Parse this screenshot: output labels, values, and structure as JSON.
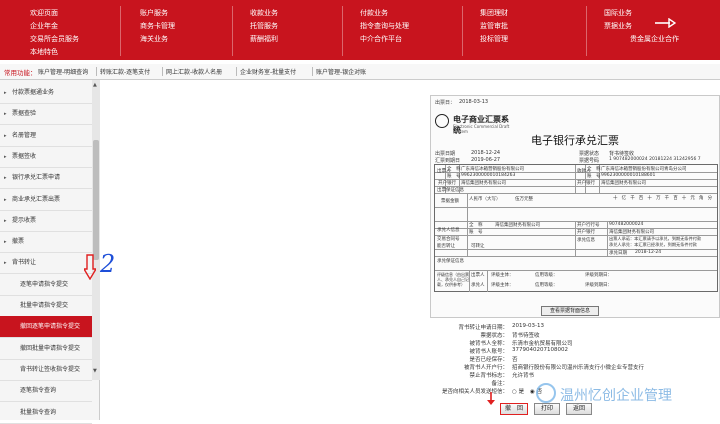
{
  "topnav": {
    "row1": [
      "欢迎页面",
      "账户服务",
      "收款业务",
      "付款业务",
      "集团理财",
      "国际业务"
    ],
    "row2": [
      "企业年金",
      "商务卡管理",
      "托管服务",
      "指令查询与处理",
      "监管审批",
      "票据业务"
    ],
    "row3": [
      "交易所会员服务",
      "海关业务",
      "薪酬福利",
      "中介合作平台",
      "投标管理",
      "贵金属企业合作"
    ],
    "row4": [
      "本地特色"
    ]
  },
  "quick": {
    "label": "常用功能：",
    "items": [
      "账户管理-明细查询",
      "转账汇款-逐笔支付",
      "网上汇款-收款人名册",
      "企业财务室-批量支付",
      "账户管理-银企对账"
    ]
  },
  "sidebar": {
    "items": [
      {
        "label": "付款票据通业务",
        "sub": false
      },
      {
        "label": "票据查验",
        "sub": false
      },
      {
        "label": "名册管理",
        "sub": false
      },
      {
        "label": "票据签收",
        "sub": false
      },
      {
        "label": "银行承兑汇票申请",
        "sub": false
      },
      {
        "label": "商业承兑汇票出票",
        "sub": false
      },
      {
        "label": "提示收票",
        "sub": false
      },
      {
        "label": "撤票",
        "sub": false
      },
      {
        "label": "背书转让",
        "sub": false
      },
      {
        "label": "逐笔申请指令提交",
        "sub": true
      },
      {
        "label": "批量申请指令提交",
        "sub": true
      },
      {
        "label": "撤回逐笔申请指令提交",
        "sub": true,
        "active": true
      },
      {
        "label": "撤回批量申请指令提交",
        "sub": true
      },
      {
        "label": "背书转让签收指令提交",
        "sub": true
      },
      {
        "label": "逐笔指令查询",
        "sub": true
      },
      {
        "label": "批量指令查询",
        "sub": true
      }
    ]
  },
  "annotation": {
    "number": "2"
  },
  "doc": {
    "issue_label": "出票日：",
    "issue_date": "2018-03-13",
    "bank_name": "电子商业汇票系统",
    "bank_name_en": "Electronic Commercial Draft System",
    "title": "电子银行承兑汇票",
    "issue_date_label": "出票日期",
    "issue_date_value": "2018-12-24",
    "due_date_label": "汇票到期日",
    "due_date_value": "2019-06-27",
    "status_label": "票据状态",
    "status_value": "背书待签收",
    "number_label": "票据号码",
    "number_value": "1 907482000024 20181224 31242956 7",
    "drawer_label": "出票人",
    "payee_label": "收款人",
    "full_name_label": "全　称",
    "account_label": "账　号",
    "bank_label": "开户银行",
    "drawer_name": "广东海信冰箱营销股份有限公司",
    "drawer_account": "9962300000010184263",
    "drawer_bank": "海信集团财务有限公司",
    "payee_name": "广东海信冰箱营销股份有限公司青岛分公司",
    "payee_account": "9962300000010188601",
    "payee_bank": "海信集团财务有限公司",
    "guarantee_label": "出票保证信息",
    "amount_label": "票据金额",
    "amount_cn_label": "人民币（大写）",
    "amount_cn": "伍万元整",
    "digits": [
      "十",
      "亿",
      "千",
      "百",
      "十",
      "万",
      "千",
      "百",
      "十",
      "元",
      "角",
      "分"
    ],
    "acceptor_label": "承兑人信息",
    "acceptor_name": "海信集团财务有限公司",
    "acceptor_bank_no": "907482000024",
    "acceptor_bank": "海信集团财务有限公司",
    "bank_no_label": "开户行行号",
    "trade_label": "交易合同号",
    "transfer_label": "能否转让",
    "transfer_value": "可转让",
    "accept_info_label": "承兑信息",
    "accept_promise": "出票人承诺：本汇票请予以承兑，到期无条件付款",
    "accept_promise2": "承兑人承兑：本汇票已经承兑，到期无条件付款",
    "accept_date_label": "承兑日期",
    "accept_date": "2018-12-24",
    "guarantor_label": "承兑保证信息",
    "rating_label": "评级信息（由出票人、承兑人自己记载，仅供参考）",
    "drawer_short": "出票人",
    "acceptor_short": "承兑人",
    "rating_org": "评级主体：",
    "credit_grade": "信用等级：",
    "rating_due": "评级到期日：",
    "view_button": "查看票据背面信息"
  },
  "info": {
    "rows": [
      {
        "label": "背书转让申请日期：",
        "value": "2019-03-13"
      },
      {
        "label": "票据状态：",
        "value": "背书待签收"
      },
      {
        "label": "被背书人全称：",
        "value": "乐清市金杭贸易有限公司"
      },
      {
        "label": "被背书人账号：",
        "value": "3779040207108002"
      },
      {
        "label": "是否已经保存：",
        "value": "否"
      },
      {
        "label": "被背书人开户行：",
        "value": "招商银行股份有限公司温州乐清支行小微企业专营支行"
      },
      {
        "label": "禁止背书标志：",
        "value": "允许背书"
      },
      {
        "label": "备注：",
        "value": ""
      },
      {
        "label": "是否向相关人员发送短信：",
        "value": ""
      }
    ],
    "radio_yes": "是",
    "radio_no": "否"
  },
  "buttons": {
    "withdraw": "撤　回",
    "print": "打印",
    "back": "返回"
  },
  "watermark": {
    "text": "温州忆创企业管理"
  },
  "colors": {
    "brand": "#c8141e",
    "annotation": "#1e4fd8"
  }
}
